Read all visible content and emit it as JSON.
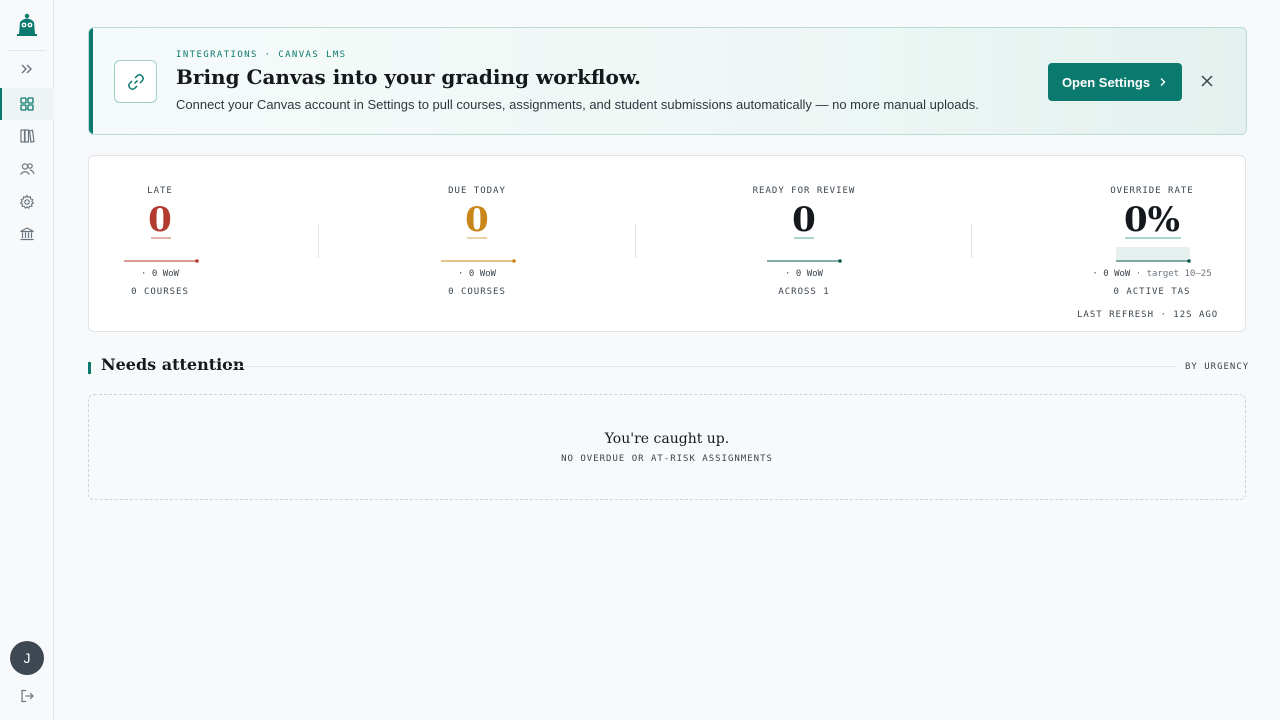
{
  "colors": {
    "accent": "#0b7a6e",
    "late": "#b33a2e",
    "due_today": "#c9861a",
    "neutral": "#15191d"
  },
  "sidebar": {
    "logo_icon": "owl-logo-icon",
    "items": [
      {
        "name": "expand",
        "icon": "double-chevron-right-icon",
        "active": false
      },
      {
        "name": "dashboard",
        "icon": "grid-icon",
        "active": true
      },
      {
        "name": "courses",
        "icon": "books-icon",
        "active": false
      },
      {
        "name": "people",
        "icon": "users-icon",
        "active": false
      },
      {
        "name": "settings",
        "icon": "gear-icon",
        "active": false
      },
      {
        "name": "institution",
        "icon": "bank-icon",
        "active": false
      }
    ],
    "avatar_initial": "J",
    "logout_icon": "logout-icon"
  },
  "banner": {
    "eyebrow": "INTEGRATIONS · CANVAS LMS",
    "title": "Bring Canvas into your grading workflow.",
    "description": "Connect your Canvas account in Settings to pull courses, assignments, and student submissions automatically — no more manual uploads.",
    "button_label": "Open Settings",
    "link_icon": "link-icon",
    "close_icon": "close-icon"
  },
  "stats": [
    {
      "label": "LATE",
      "value": "0",
      "wow": "· 0 WoW",
      "sub": "0 COURSES",
      "color": "#b33a2e"
    },
    {
      "label": "DUE TODAY",
      "value": "0",
      "wow": "· 0 WoW",
      "sub": "0 COURSES",
      "color": "#c9861a"
    },
    {
      "label": "READY FOR REVIEW",
      "value": "0",
      "wow": "· 0 WoW",
      "sub": "ACROSS 1",
      "color": "#15191d"
    },
    {
      "label": "OVERRIDE RATE",
      "value": "0%",
      "wow": "· 0 WoW",
      "target": "· target 10–25",
      "sub": "0 ACTIVE TAS",
      "color": "#15191d"
    }
  ],
  "last_refresh": "LAST REFRESH · 12S AGO",
  "needs_attention": {
    "title": "Needs attention",
    "sort_label": "BY URGENCY",
    "empty_title": "You're caught up.",
    "empty_subtitle": "NO OVERDUE OR AT-RISK ASSIGNMENTS"
  }
}
